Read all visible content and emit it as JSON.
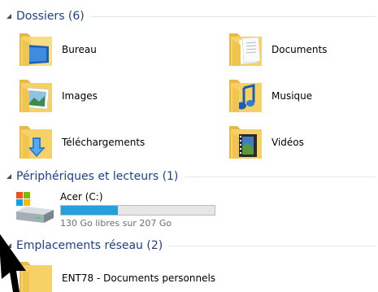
{
  "groups": {
    "folders": {
      "title": "Dossiers (6)",
      "items": [
        {
          "label": "Bureau",
          "icon": "desktop-folder-icon"
        },
        {
          "label": "Documents",
          "icon": "documents-folder-icon"
        },
        {
          "label": "Images",
          "icon": "images-folder-icon"
        },
        {
          "label": "Musique",
          "icon": "music-folder-icon"
        },
        {
          "label": "Téléchargements",
          "icon": "downloads-folder-icon"
        },
        {
          "label": "Vidéos",
          "icon": "videos-folder-icon"
        }
      ]
    },
    "devices": {
      "title": "Périphériques et lecteurs (1)",
      "drive": {
        "name": "Acer (C:)",
        "free_text": "130 Go libres sur 207 Go",
        "used_fraction": 0.37,
        "icon": "hard-drive-icon"
      }
    },
    "network": {
      "title": "Emplacements réseau (2)",
      "items": [
        {
          "label": "ENT78 - Documents personnels",
          "icon": "network-folder-icon"
        }
      ]
    }
  },
  "colors": {
    "group_title": "#1e3f8a",
    "folder_yellow": "#f6d266",
    "drive_bar_fill": "#26a0da",
    "separator": "#e3e8f0"
  }
}
